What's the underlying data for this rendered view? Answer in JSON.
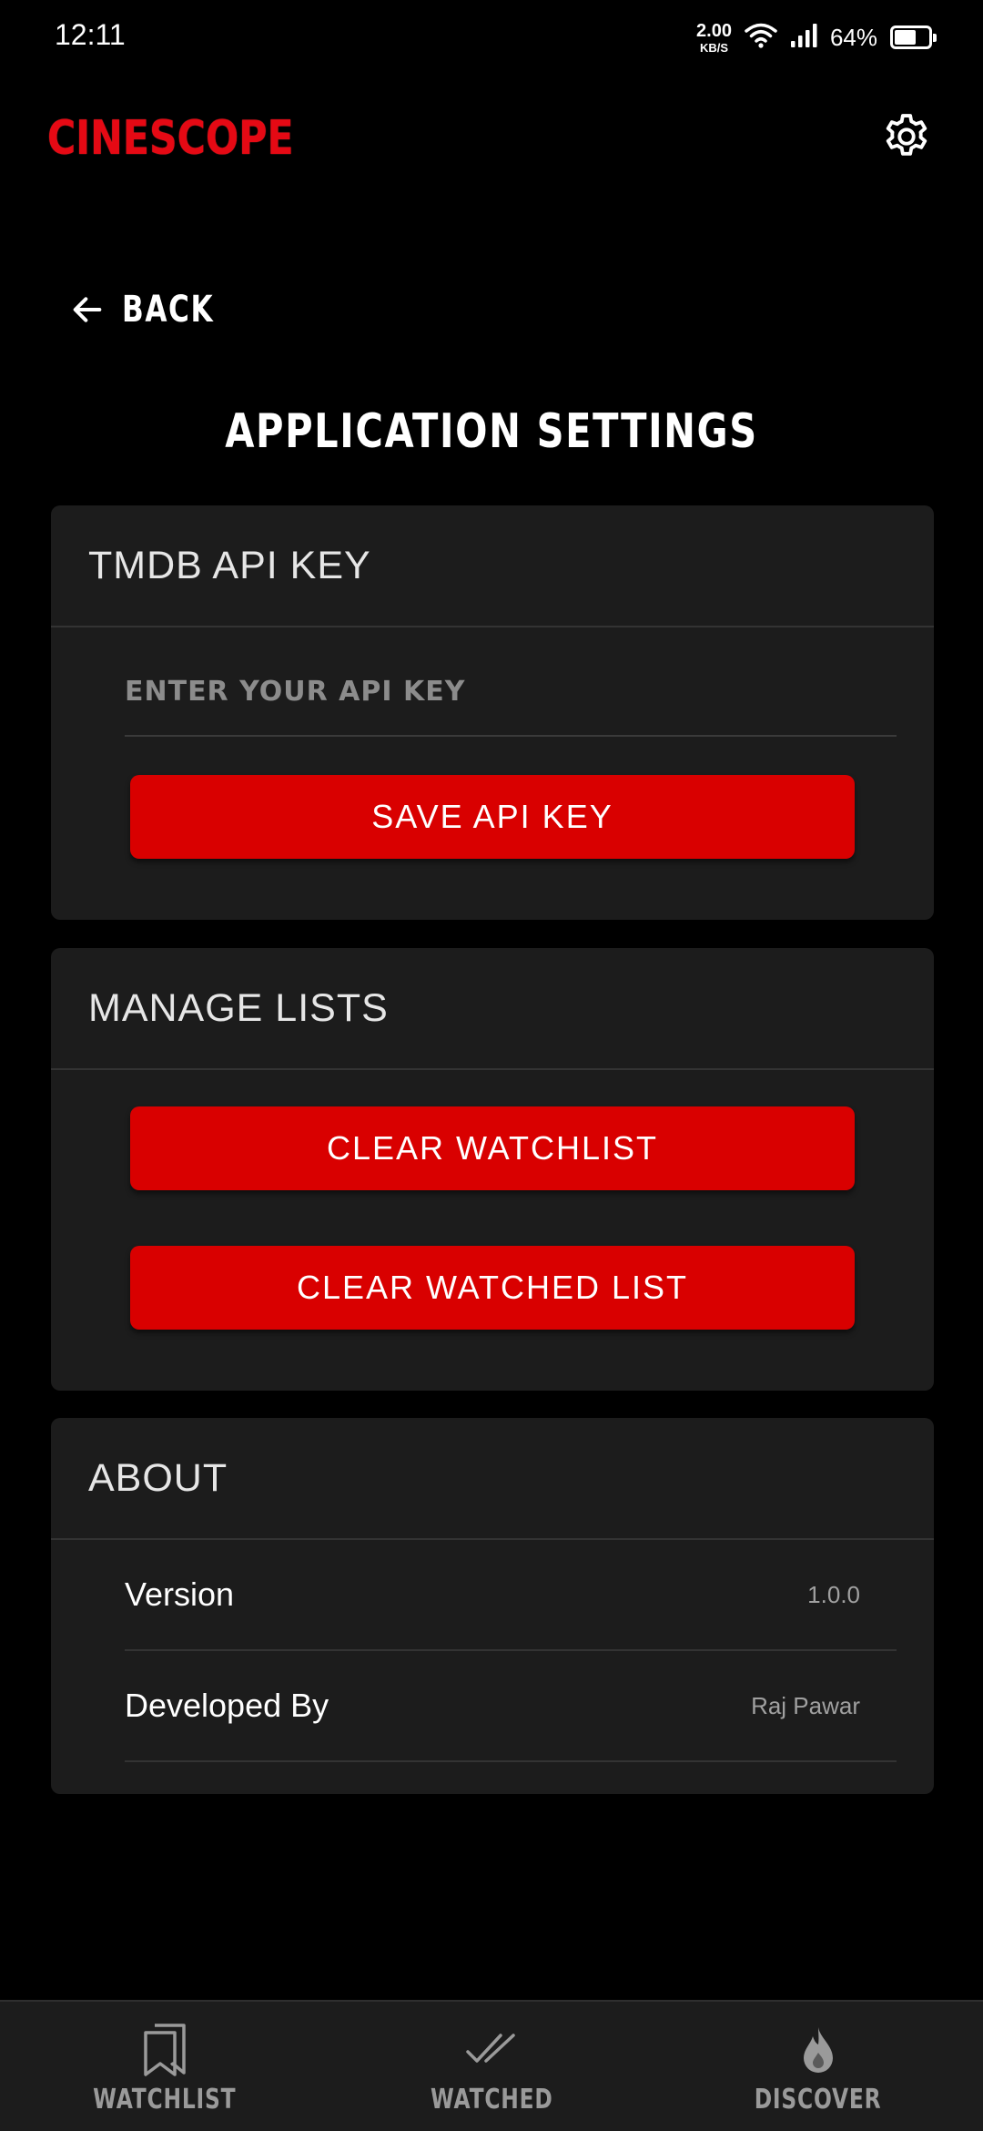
{
  "status_bar": {
    "time": "12:11",
    "net_speed_value": "2.00",
    "net_speed_unit": "KB/S",
    "battery_percent": "64%",
    "battery_level": 0.64
  },
  "header": {
    "app_name": "CINESCOPE",
    "settings_icon": "gear-icon",
    "brand_color": "#e50914"
  },
  "back": {
    "label": "BACK",
    "icon": "arrow-left-icon"
  },
  "page_title": "APPLICATION SETTINGS",
  "api_section": {
    "title": "TMDB API KEY",
    "input_value": "",
    "input_placeholder": "ENTER YOUR API KEY",
    "save_label": "SAVE API KEY"
  },
  "lists_section": {
    "title": "MANAGE LISTS",
    "clear_watchlist_label": "CLEAR WATCHLIST",
    "clear_watched_label": "CLEAR WATCHED LIST"
  },
  "about_section": {
    "title": "ABOUT",
    "rows": [
      {
        "label": "Version",
        "value": "1.0.0"
      },
      {
        "label": "Developed By",
        "value": "Raj Pawar"
      }
    ]
  },
  "bottom_nav": {
    "items": [
      {
        "label": "WATCHLIST",
        "icon": "bookmarks-icon"
      },
      {
        "label": "WATCHED",
        "icon": "double-check-icon"
      },
      {
        "label": "DISCOVER",
        "icon": "flame-icon"
      }
    ]
  },
  "colors": {
    "accent": "#d90000",
    "card_bg": "#1c1c1c",
    "background": "#000000"
  }
}
